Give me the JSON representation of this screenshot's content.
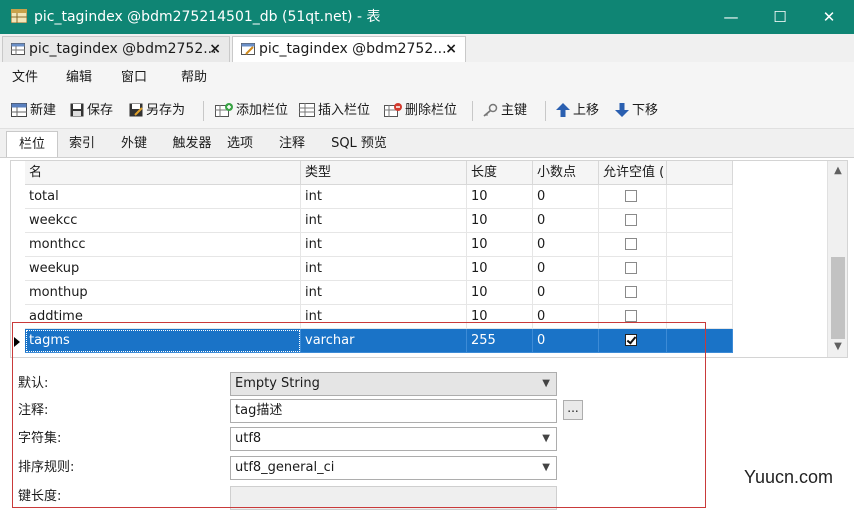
{
  "window": {
    "title": "pic_tagindex @bdm275214501_db (51qt.net) - 表",
    "controls": {
      "minimize": "—",
      "maximize": "☐",
      "close": "✕"
    },
    "accent": "#0f8574"
  },
  "doc_tabs": [
    {
      "label": "pic_tagindex @bdm2752...",
      "close": "×"
    },
    {
      "label": "pic_tagindex @bdm2752...",
      "close": "×",
      "active": true
    }
  ],
  "menu": [
    "文件",
    "编辑",
    "窗口",
    "帮助"
  ],
  "toolbar": {
    "new": "新建",
    "save": "保存",
    "save_as": "另存为",
    "add_column": "添加栏位",
    "insert_column": "插入栏位",
    "delete_column": "删除栏位",
    "primary_key": "主键",
    "move_up": "上移",
    "move_down": "下移"
  },
  "sub_tabs": [
    "栏位",
    "索引",
    "外键",
    "触发器",
    "选项",
    "注释",
    "SQL 预览"
  ],
  "grid": {
    "headers": [
      "名",
      "类型",
      "长度",
      "小数点",
      "允许空值 ("
    ],
    "rows": [
      {
        "name": "total",
        "type": "int",
        "length": "10",
        "decimals": "0",
        "nullable": false
      },
      {
        "name": "weekcc",
        "type": "int",
        "length": "10",
        "decimals": "0",
        "nullable": false
      },
      {
        "name": "monthcc",
        "type": "int",
        "length": "10",
        "decimals": "0",
        "nullable": false
      },
      {
        "name": "weekup",
        "type": "int",
        "length": "10",
        "decimals": "0",
        "nullable": false
      },
      {
        "name": "monthup",
        "type": "int",
        "length": "10",
        "decimals": "0",
        "nullable": false
      },
      {
        "name": "addtime",
        "type": "int",
        "length": "10",
        "decimals": "0",
        "nullable": false
      },
      {
        "name": "tagms",
        "type": "varchar",
        "length": "255",
        "decimals": "0",
        "nullable": true,
        "selected": true
      }
    ],
    "selection_color": "#1a73c7"
  },
  "properties": {
    "default_label": "默认:",
    "default_value": "Empty String",
    "comment_label": "注释:",
    "comment_value": "tag描述",
    "comment_button": "...",
    "charset_label": "字符集:",
    "charset_value": "utf8",
    "collation_label": "排序规则:",
    "collation_value": "utf8_general_ci",
    "key_length_label": "键长度:",
    "key_length_value": ""
  },
  "watermark": "Yuucn.com"
}
